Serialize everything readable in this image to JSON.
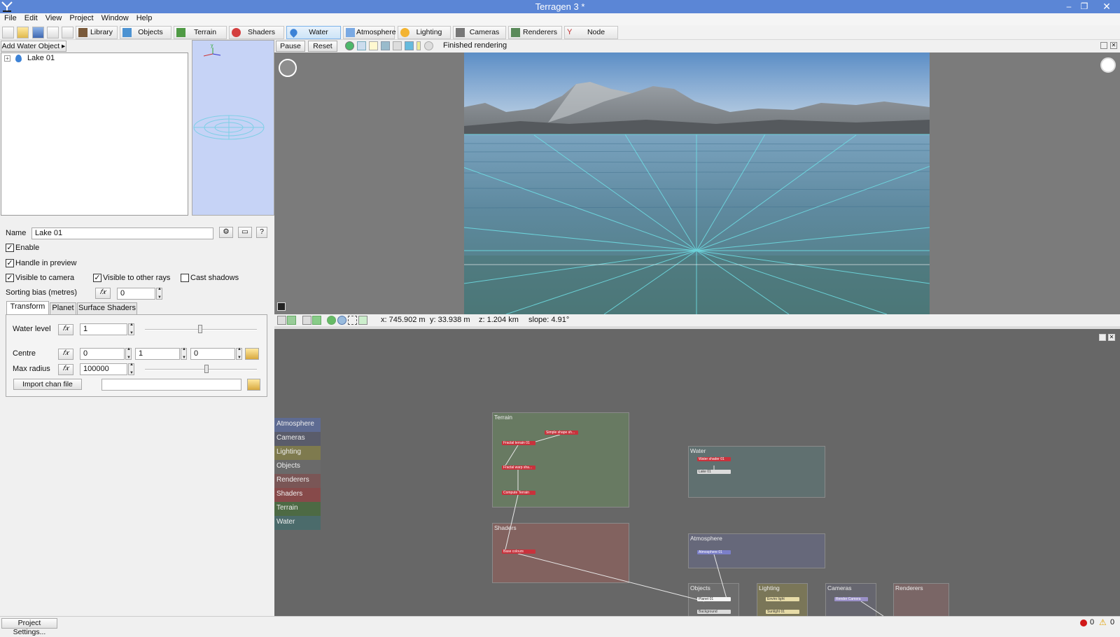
{
  "window": {
    "title": "Terragen 3 *"
  },
  "menu": [
    "File",
    "Edit",
    "View",
    "Project",
    "Window",
    "Help"
  ],
  "toolbar": {
    "tabs": [
      "Library",
      "Objects",
      "Terrain",
      "Shaders",
      "Water",
      "Atmosphere",
      "Lighting",
      "Cameras",
      "Renderers",
      "Node Network"
    ],
    "active": "Water"
  },
  "left": {
    "add_button": "Add Water Object",
    "tree_item": "Lake 01",
    "name_label": "Name",
    "name_value": "Lake 01",
    "help_glyph": "?",
    "enable": "Enable",
    "handle_preview": "Handle in preview",
    "visible_camera": "Visible to camera",
    "visible_rays": "Visible to other rays",
    "cast_shadows": "Cast shadows",
    "sorting_label": "Sorting bias (metres)",
    "sorting_value": "0",
    "tabs": [
      "Transform",
      "Planet",
      "Surface Shaders"
    ],
    "water_level_label": "Water level",
    "water_level_value": "1",
    "centre_label": "Centre",
    "centre_x": "0",
    "centre_y": "1",
    "centre_z": "0",
    "max_radius_label": "Max radius",
    "max_radius_value": "100000",
    "import_button": "Import chan file",
    "fx_glyph": "𝑓𝑥"
  },
  "render": {
    "pause": "Pause",
    "reset": "Reset",
    "status": "Finished rendering"
  },
  "coords": {
    "x": "x: 745.902 m",
    "y": "y: 33.938 m",
    "z": "z: 1.204 km",
    "slope": "slope: 4.91°"
  },
  "nodenet": {
    "categories": [
      "Atmosphere",
      "Cameras",
      "Lighting",
      "Objects",
      "Renderers",
      "Shaders",
      "Terrain",
      "Water"
    ],
    "groups": {
      "terrain": "Terrain",
      "shaders": "Shaders",
      "water": "Water",
      "atmosphere": "Atmosphere",
      "objects": "Objects",
      "lighting": "Lighting",
      "cameras": "Cameras",
      "renderers": "Renderers"
    },
    "nodes": {
      "simple_shape": "Simple shape sh...",
      "fractal_terrain": "Fractal terrain 01",
      "fractal_warp": "Fractal warp sha...",
      "compute_terrain": "Compute Terrain",
      "base_colours": "Base colours",
      "water_shader": "Water shader 01",
      "lake": "Lake 01",
      "atmosphere": "Atmosphere 01",
      "planet": "Planet 01",
      "background": "Background",
      "enviro_light": "Enviro light",
      "sunlight": "Sunlight 01",
      "render_camera": "Render Camera"
    }
  },
  "status": {
    "project_settings": "Project Settings...",
    "errors": "0",
    "warnings": "0"
  },
  "colors": {
    "titlebar": "#5b86d6",
    "node_red": "#c8323c",
    "node_blue": "#7b7fc9"
  }
}
